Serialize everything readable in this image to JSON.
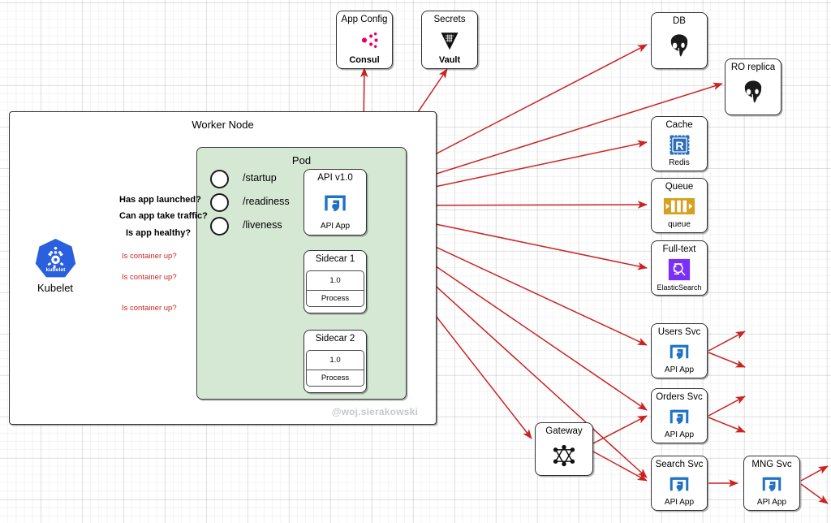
{
  "diagram": {
    "watermark": "@woj.sierakowski",
    "colors": {
      "pod_fill": "#d5e8d4",
      "arrow_red": "#cc2222",
      "arrow_gray": "#5a5a5a",
      "api_blue": "#1f72c4",
      "consul_pink": "#e5006e",
      "redis_blue": "#2a6ebb",
      "queue_gold": "#d6a020",
      "elastic_purple": "#7b2ff7",
      "kubelet_blue": "#2a5fdd"
    }
  },
  "worker_node": {
    "title": "Worker Node"
  },
  "pod": {
    "title": "Pod"
  },
  "kubelet": {
    "label": "Kubelet",
    "badge": "kubelet",
    "icon": "kubernetes-icon"
  },
  "probes": [
    {
      "path": "/startup",
      "question": "Has app launched?"
    },
    {
      "path": "/readiness",
      "question": "Can app take traffic?"
    },
    {
      "path": "/liveness",
      "question": "Is app healthy?"
    }
  ],
  "container_checks": [
    {
      "label": "Is container up?"
    },
    {
      "label": "Is container up?"
    },
    {
      "label": "Is container up?"
    }
  ],
  "pod_containers": [
    {
      "name": "api",
      "title": "API v1.0",
      "subtitle": "API App",
      "icon": "api-app-icon"
    },
    {
      "name": "sidecar1",
      "title": "Sidecar 1",
      "version": "1.0",
      "process": "Process"
    },
    {
      "name": "sidecar2",
      "title": "Sidecar 2",
      "version": "1.0",
      "process": "Process"
    }
  ],
  "top_nodes": [
    {
      "name": "app-config",
      "title": "App Config",
      "subtitle": "Consul",
      "icon": "consul-icon"
    },
    {
      "name": "secrets",
      "title": "Secrets",
      "subtitle": "Vault",
      "icon": "vault-icon"
    }
  ],
  "backing_services": [
    {
      "name": "db",
      "title": "DB",
      "subtitle": "",
      "icon": "postgresql-icon"
    },
    {
      "name": "ro-replica",
      "title": "RO replica",
      "subtitle": "",
      "icon": "postgresql-icon"
    },
    {
      "name": "cache",
      "title": "Cache",
      "subtitle": "Redis",
      "icon": "redis-icon"
    },
    {
      "name": "queue",
      "title": "Queue",
      "subtitle": "queue",
      "icon": "queue-icon"
    },
    {
      "name": "fulltext",
      "title": "Full-text",
      "subtitle": "ElasticSearch",
      "icon": "elasticsearch-icon"
    }
  ],
  "downstream_services": [
    {
      "name": "users-svc",
      "title": "Users Svc",
      "subtitle": "API App",
      "icon": "api-app-icon"
    },
    {
      "name": "orders-svc",
      "title": "Orders Svc",
      "subtitle": "API App",
      "icon": "api-app-icon"
    },
    {
      "name": "search-svc",
      "title": "Search Svc",
      "subtitle": "API App",
      "icon": "api-app-icon"
    },
    {
      "name": "mng-svc",
      "title": "MNG Svc",
      "subtitle": "API App",
      "icon": "api-app-icon"
    }
  ],
  "gateway": {
    "title": "Gateway",
    "icon": "graphql-icon"
  }
}
